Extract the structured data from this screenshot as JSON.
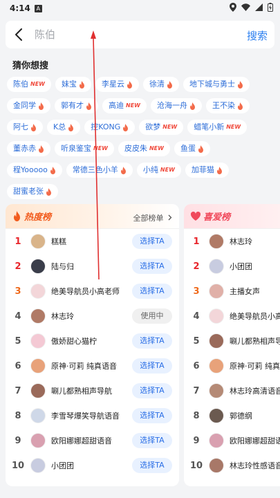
{
  "status": {
    "time": "4:14",
    "app_badge": "A"
  },
  "search": {
    "placeholder": "陈伯",
    "button": "搜索"
  },
  "suggest": {
    "title": "猜你想搜",
    "rows": [
      [
        {
          "label": "陈伯",
          "badge": "new"
        },
        {
          "label": "妹宝",
          "badge": "hot"
        },
        {
          "label": "李星云",
          "badge": "hot"
        },
        {
          "label": "徐清",
          "badge": "hot"
        },
        {
          "label": "地下城与勇士",
          "badge": "hot"
        }
      ],
      [
        {
          "label": "金同学",
          "badge": "hot"
        },
        {
          "label": "郭有才",
          "badge": "hot"
        },
        {
          "label": "高迪",
          "badge": "new"
        },
        {
          "label": "沧海一舟",
          "badge": "hot"
        },
        {
          "label": "王不染",
          "badge": "hot"
        }
      ],
      [
        {
          "label": "阿七",
          "badge": "hot"
        },
        {
          "label": "K总",
          "badge": "hot"
        },
        {
          "label": "控KONG",
          "badge": "hot"
        },
        {
          "label": "欲梦",
          "badge": "new"
        },
        {
          "label": "蜡笔小新",
          "badge": "new"
        }
      ],
      [
        {
          "label": "董赤赤",
          "badge": "hot"
        },
        {
          "label": "听泉鉴宝",
          "badge": "new"
        },
        {
          "label": "皮皮朱",
          "badge": "new"
        },
        {
          "label": "鱼蛋",
          "badge": "hot"
        }
      ],
      [
        {
          "label": "程Yooooo",
          "badge": "hot"
        },
        {
          "label": "常德三色小羊",
          "badge": "hot"
        },
        {
          "label": "小纯",
          "badge": "new"
        },
        {
          "label": "加菲猫",
          "badge": "hot"
        }
      ],
      [
        {
          "label": "甜蜜老张",
          "badge": "hot"
        }
      ]
    ],
    "new_text": "NEW"
  },
  "hot_ranking": {
    "title": "热度榜",
    "all_label": "全部榜单",
    "select_label": "选择TA",
    "using_label": "使用中",
    "items": [
      {
        "rank": "1",
        "name": "糕糕",
        "using": false,
        "avatar_color": "#d9b48a"
      },
      {
        "rank": "2",
        "name": "陆与归",
        "using": false,
        "avatar_color": "#3a3d4a"
      },
      {
        "rank": "3",
        "name": "绝美导航员小高老师",
        "using": false,
        "avatar_color": "#f3d6d9"
      },
      {
        "rank": "4",
        "name": "林志玲",
        "using": true,
        "avatar_color": "#b07a66"
      },
      {
        "rank": "5",
        "name": "傲娇甜心猫柠",
        "using": false,
        "avatar_color": "#f4c9d4"
      },
      {
        "rank": "6",
        "name": "原神·可莉 纯真语音",
        "using": false,
        "avatar_color": "#e8a27a"
      },
      {
        "rank": "7",
        "name": "唰儿都熟相声导航",
        "using": false,
        "avatar_color": "#9a6a5a"
      },
      {
        "rank": "8",
        "name": "李雪琴爆笑导航语音",
        "using": false,
        "avatar_color": "#cfd8e8"
      },
      {
        "rank": "9",
        "name": "欧阳娜娜超甜语音",
        "using": false,
        "avatar_color": "#d9a0b0"
      },
      {
        "rank": "10",
        "name": "小团团",
        "using": false,
        "avatar_color": "#c8cce0"
      }
    ]
  },
  "love_ranking": {
    "title": "喜爱榜",
    "items": [
      {
        "rank": "1",
        "name": "林志玲",
        "avatar_color": "#b07a66"
      },
      {
        "rank": "2",
        "name": "小团团",
        "avatar_color": "#c8cce0"
      },
      {
        "rank": "3",
        "name": "主播女声",
        "avatar_color": "#e0b0a8"
      },
      {
        "rank": "4",
        "name": "绝美导航员小高",
        "avatar_color": "#f3d6d9"
      },
      {
        "rank": "5",
        "name": "唰儿都熟相声导",
        "avatar_color": "#9a6a5a"
      },
      {
        "rank": "6",
        "name": "原神·可莉 纯真语",
        "avatar_color": "#e8a27a"
      },
      {
        "rank": "7",
        "name": "林志玲高清语音",
        "avatar_color": "#b58a76"
      },
      {
        "rank": "8",
        "name": "郭德纲",
        "avatar_color": "#6b5a50"
      },
      {
        "rank": "9",
        "name": "欧阳娜娜超甜语",
        "avatar_color": "#d9a0b0"
      },
      {
        "rank": "10",
        "name": "林志玲性感语音",
        "avatar_color": "#a87868"
      }
    ]
  },
  "colors": {
    "accent": "#2b7ff0",
    "hot": "#f25c1e",
    "love": "#f04a5c",
    "annotation": "#e03030"
  }
}
